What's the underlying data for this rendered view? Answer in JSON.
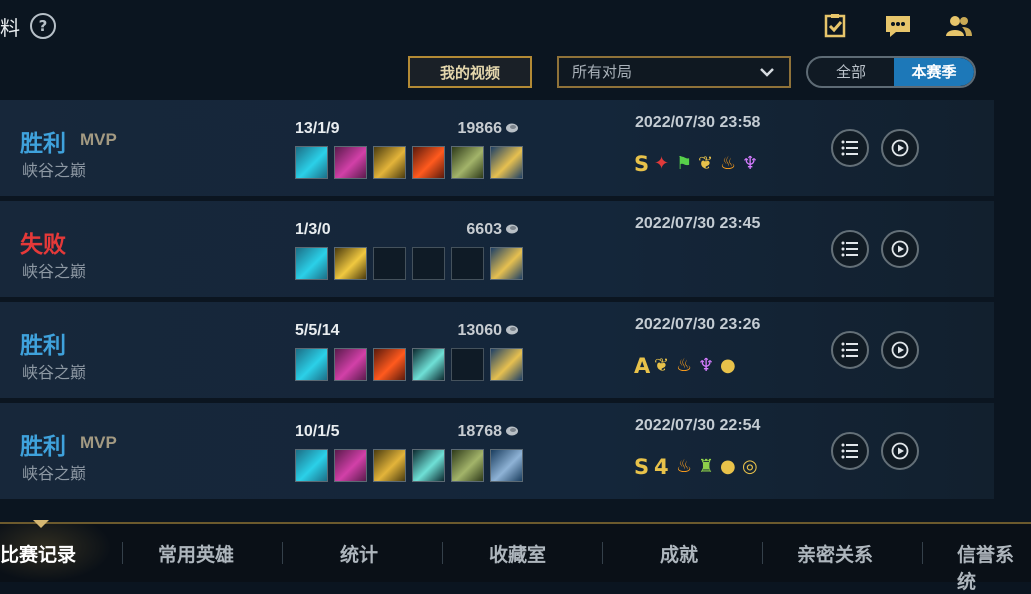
{
  "header": {
    "title_fragment": "料",
    "help_icon": "?",
    "icons": [
      "checklist-icon",
      "chat-icon",
      "friends-icon"
    ]
  },
  "toolbar": {
    "my_video_label": "我的视频",
    "filter_value": "所有对局",
    "segment_all": "全部",
    "segment_season": "本赛季",
    "selected_segment": "本赛季"
  },
  "matches": [
    {
      "result": "胜利",
      "win": true,
      "mvp": "MVP",
      "mode": "峡谷之巅",
      "kda": "13/1/9",
      "gold": "19866",
      "time": "2022/07/30 23:58",
      "rating": "S",
      "items": [
        "boots-icon",
        "sword-icon",
        "gold-blade-icon",
        "fire-blade-icon",
        "axe-icon",
        "trinket-icon"
      ],
      "badges": [
        "kill-badge-icon",
        "flag-badge-icon",
        "leaf-badge-icon",
        "flame-badge-icon",
        "wings-badge-icon"
      ]
    },
    {
      "result": "失败",
      "win": false,
      "mvp": "",
      "mode": "峡谷之巅",
      "kda": "1/3/0",
      "gold": "6603",
      "time": "2022/07/30 23:45",
      "rating": "",
      "items": [
        "boots-icon",
        "cross-blade-icon",
        "empty",
        "empty",
        "empty",
        "trinket-icon"
      ],
      "badges": []
    },
    {
      "result": "胜利",
      "win": true,
      "mvp": "",
      "mode": "峡谷之巅",
      "kda": "5/5/14",
      "gold": "13060",
      "time": "2022/07/30 23:26",
      "rating": "A",
      "items": [
        "boots-icon",
        "sword-icon",
        "fire-blade-icon",
        "dagger-icon",
        "empty",
        "trinket-icon"
      ],
      "badges": [
        "leaf-badge-icon",
        "flame-badge-icon",
        "wings-badge-icon",
        "coin-badge-icon"
      ]
    },
    {
      "result": "胜利",
      "win": true,
      "mvp": "MVP",
      "mode": "峡谷之巅",
      "kda": "10/1/5",
      "gold": "18768",
      "time": "2022/07/30 22:54",
      "rating": "S",
      "quadra": "4",
      "items": [
        "boots-icon",
        "sword-icon",
        "gold-blade-icon",
        "dagger-icon",
        "axe-icon",
        "bag-icon"
      ],
      "badges": [
        "quadra-badge-icon",
        "flame-badge-icon",
        "tower-badge-icon",
        "coin-badge-icon",
        "coins-badge-icon"
      ]
    }
  ],
  "tabs": [
    {
      "label": "比赛记录",
      "active": true
    },
    {
      "label": "常用英雄",
      "active": false
    },
    {
      "label": "统计",
      "active": false
    },
    {
      "label": "收藏室",
      "active": false
    },
    {
      "label": "成就",
      "active": false
    },
    {
      "label": "亲密关系",
      "active": false
    },
    {
      "label": "信誉系统",
      "active": false
    }
  ],
  "colors": {
    "accent_gold": "#b38a35",
    "win_blue": "#3fa2dc",
    "loss_red": "#e53939",
    "segment_selected": "#1d78b8"
  }
}
